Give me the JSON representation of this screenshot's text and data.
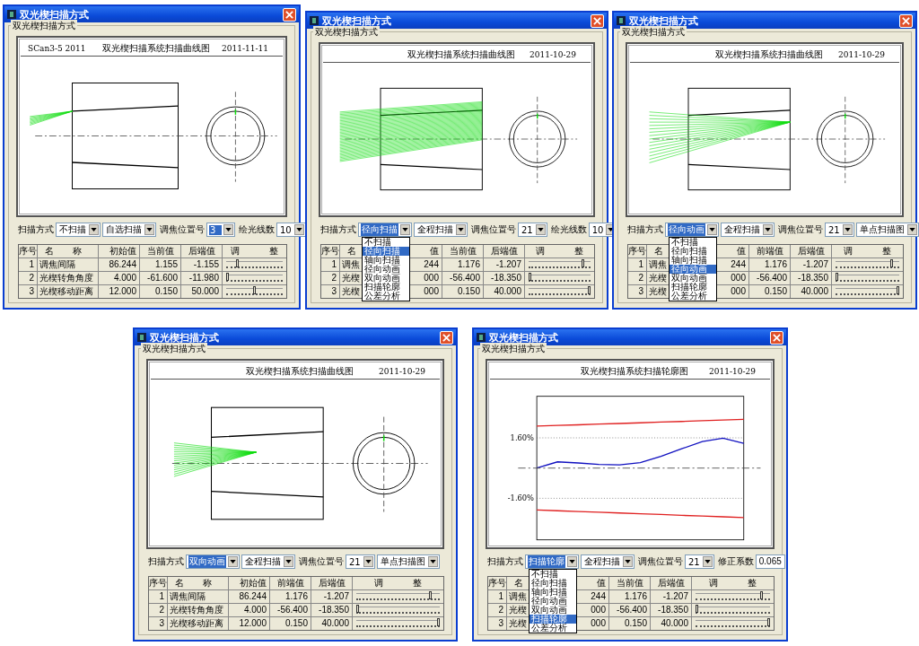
{
  "windows": [
    {
      "title": "双光楔扫描方式",
      "group_label": "双光楔扫描方式",
      "plot": {
        "kind": "scan",
        "left_text": "SCan3-5 2011",
        "title": "双光楔扫描系统扫描曲线图",
        "date": "2011-11-11"
      },
      "controls": [
        {
          "kind": "label",
          "text": "扫描方式"
        },
        {
          "kind": "combo",
          "value": "不扫描",
          "highlighted": false
        },
        {
          "kind": "combo",
          "value": "自选扫描",
          "highlighted": false
        },
        {
          "kind": "label",
          "text": "调焦位置号"
        },
        {
          "kind": "combo",
          "value": "3",
          "highlighted": true
        },
        {
          "kind": "label",
          "text": "绘光线数"
        },
        {
          "kind": "combo",
          "value": "10",
          "highlighted": false
        }
      ],
      "table": {
        "header": {
          "no": "序号",
          "name": "名 称",
          "initial": "初始值",
          "current": "当前值",
          "back": "后端值",
          "adjust": "调 整"
        },
        "rows": [
          {
            "no": "1",
            "name": "调焦间隔",
            "initial": "86.244",
            "current": "1.155",
            "back": "-1.155",
            "level": 0.18
          },
          {
            "no": "2",
            "name": "光楔转角角度",
            "initial": "4.000",
            "current": "-61.600",
            "back": "-11.980",
            "level": 0
          },
          {
            "no": "3",
            "name": "光楔移动距离",
            "initial": "12.000",
            "current": "0.150",
            "back": "50.000",
            "level": 0.5
          }
        ]
      }
    },
    {
      "title": "双光楔扫描方式",
      "group_label": "双光楔扫描方式",
      "plot": {
        "kind": "scan",
        "title": "双光楔扫描系统扫描曲线图",
        "date": "2011-10-29"
      },
      "controls": [
        {
          "kind": "label",
          "text": "扫描方式"
        },
        {
          "kind": "combo",
          "value": "径向扫描",
          "highlighted": true,
          "options": [
            {
              "label": "不扫描",
              "selected": false
            },
            {
              "label": "径向扫描",
              "selected": true
            },
            {
              "label": "轴向扫描",
              "selected": false
            },
            {
              "label": "径向动画",
              "selected": false
            },
            {
              "label": "双向动画",
              "selected": false
            },
            {
              "label": "扫描轮廓",
              "selected": false
            },
            {
              "label": "公差分析",
              "selected": false
            }
          ]
        },
        {
          "kind": "combo",
          "value": "全程扫描",
          "highlighted": false
        },
        {
          "kind": "label",
          "text": "调焦位置号"
        },
        {
          "kind": "combo",
          "value": "21",
          "highlighted": false
        },
        {
          "kind": "label",
          "text": "绘光线数"
        },
        {
          "kind": "combo",
          "value": "10",
          "highlighted": false
        }
      ],
      "table": {
        "header": {
          "no": "序号",
          "name": "名",
          "initial": "值",
          "current": "当前值",
          "back": "后端值",
          "adjust": "调 整"
        },
        "rows": [
          {
            "no": "1",
            "name": "调焦",
            "initial": "244",
            "current": "1.176",
            "back": "-1.207",
            "level": 0.9
          },
          {
            "no": "2",
            "name": "光楔",
            "initial": "000",
            "current": "-56.400",
            "back": "-18.350",
            "level": 0
          },
          {
            "no": "3",
            "name": "光楔",
            "initial": "000",
            "current": "0.150",
            "back": "40.000",
            "level": 1
          }
        ]
      }
    },
    {
      "title": "双光楔扫描方式",
      "group_label": "双光楔扫描方式",
      "plot": {
        "kind": "scan",
        "title": "双光楔扫描系统扫描曲线图",
        "date": "2011-10-29"
      },
      "controls": [
        {
          "kind": "label",
          "text": "扫描方式"
        },
        {
          "kind": "combo",
          "value": "径向动画",
          "highlighted": true,
          "options": [
            {
              "label": "不扫描",
              "selected": false
            },
            {
              "label": "径向扫描",
              "selected": false
            },
            {
              "label": "轴向扫描",
              "selected": false
            },
            {
              "label": "径向动画",
              "selected": true
            },
            {
              "label": "双向动画",
              "selected": false
            },
            {
              "label": "扫描轮廓",
              "selected": false
            },
            {
              "label": "公差分析",
              "selected": false
            }
          ]
        },
        {
          "kind": "combo",
          "value": "全程扫描",
          "highlighted": false
        },
        {
          "kind": "label",
          "text": "调焦位置号"
        },
        {
          "kind": "combo",
          "value": "21",
          "highlighted": false
        },
        {
          "kind": "combo",
          "value": "单点扫描图",
          "highlighted": false
        }
      ],
      "table": {
        "header": {
          "no": "序号",
          "name": "名",
          "initial": "值",
          "current": "前端值",
          "back": "后端值",
          "adjust": "调 整"
        },
        "rows": [
          {
            "no": "1",
            "name": "调焦",
            "initial": "244",
            "current": "1.176",
            "back": "-1.207",
            "level": 0.9
          },
          {
            "no": "2",
            "name": "光楔",
            "initial": "000",
            "current": "-56.400",
            "back": "-18.350",
            "level": 0
          },
          {
            "no": "3",
            "name": "光楔",
            "initial": "000",
            "current": "0.150",
            "back": "40.000",
            "level": 1
          }
        ]
      }
    },
    {
      "title": "双光楔扫描方式",
      "group_label": "双光楔扫描方式",
      "plot": {
        "kind": "scan",
        "title": "双光楔扫描系统扫描曲线图",
        "date": "2011-10-29"
      },
      "controls": [
        {
          "kind": "label",
          "text": "扫描方式"
        },
        {
          "kind": "combo",
          "value": "双向动画",
          "highlighted": true
        },
        {
          "kind": "combo",
          "value": "全程扫描",
          "highlighted": false
        },
        {
          "kind": "label",
          "text": "调焦位置号"
        },
        {
          "kind": "combo",
          "value": "21",
          "highlighted": false
        },
        {
          "kind": "combo",
          "value": "单点扫描图",
          "highlighted": false
        }
      ],
      "table": {
        "header": {
          "no": "序号",
          "name": "名 称",
          "initial": "初始值",
          "current": "前端值",
          "back": "后端值",
          "adjust": "调 整"
        },
        "rows": [
          {
            "no": "1",
            "name": "调焦间隔",
            "initial": "86.244",
            "current": "1.176",
            "back": "-1.207",
            "level": 0.9
          },
          {
            "no": "2",
            "name": "光楔转角角度",
            "initial": "4.000",
            "current": "-56.400",
            "back": "-18.350",
            "level": 0
          },
          {
            "no": "3",
            "name": "光楔移动距离",
            "initial": "12.000",
            "current": "0.150",
            "back": "40.000",
            "level": 1
          }
        ]
      }
    },
    {
      "title": "双光楔扫描方式",
      "group_label": "双光楔扫描方式",
      "plot": {
        "kind": "profile",
        "title": "双光楔扫描系统扫描轮廓图",
        "date": "2011-10-29",
        "chart_data": {
          "type": "line",
          "ylim": [
            -3.8,
            3.8
          ],
          "yticks": [
            {
              "value": 1.6,
              "label": "1.60%"
            },
            {
              "value": -1.6,
              "label": "-1.60%"
            }
          ],
          "series": [
            {
              "color": "#e02020",
              "values": [
                2.22,
                2.26,
                2.29,
                2.33,
                2.36,
                2.4,
                2.44,
                2.47,
                2.51,
                2.54,
                2.58
              ]
            },
            {
              "color": "#1010c0",
              "values": [
                0,
                0.33,
                0.27,
                0.19,
                0.17,
                0.29,
                0.62,
                1.02,
                1.4,
                1.58,
                1.31
              ]
            },
            {
              "color": "#e02020",
              "values": [
                -2.22,
                -2.26,
                -2.3,
                -2.34,
                -2.38,
                -2.42,
                -2.46,
                -2.5,
                -2.54,
                -2.58,
                -2.62
              ]
            }
          ]
        }
      },
      "controls": [
        {
          "kind": "label",
          "text": "扫描方式"
        },
        {
          "kind": "combo",
          "value": "扫描轮廓",
          "highlighted": true,
          "options": [
            {
              "label": "不扫描",
              "selected": false
            },
            {
              "label": "径向扫描",
              "selected": false
            },
            {
              "label": "轴向扫描",
              "selected": false
            },
            {
              "label": "径向动画",
              "selected": false
            },
            {
              "label": "双向动画",
              "selected": false
            },
            {
              "label": "扫描轮廓",
              "selected": true
            },
            {
              "label": "公差分析",
              "selected": false
            }
          ]
        },
        {
          "kind": "combo",
          "value": "全程扫描",
          "highlighted": false
        },
        {
          "kind": "label",
          "text": "调焦位置号"
        },
        {
          "kind": "combo",
          "value": "21",
          "highlighted": false
        },
        {
          "kind": "label",
          "text": "修正系数"
        },
        {
          "kind": "field",
          "value": "0.065"
        }
      ],
      "table": {
        "header": {
          "no": "序号",
          "name": "名",
          "initial": "值",
          "current": "当前值",
          "back": "后端值",
          "adjust": "调 整"
        },
        "rows": [
          {
            "no": "1",
            "name": "调焦",
            "initial": "244",
            "current": "1.176",
            "back": "-1.207",
            "level": 0.9
          },
          {
            "no": "2",
            "name": "光楔",
            "initial": "000",
            "current": "-56.400",
            "back": "-18.350",
            "level": 0
          },
          {
            "no": "3",
            "name": "光楔",
            "initial": "000",
            "current": "0.150",
            "back": "40.000",
            "level": 1
          }
        ]
      }
    }
  ]
}
